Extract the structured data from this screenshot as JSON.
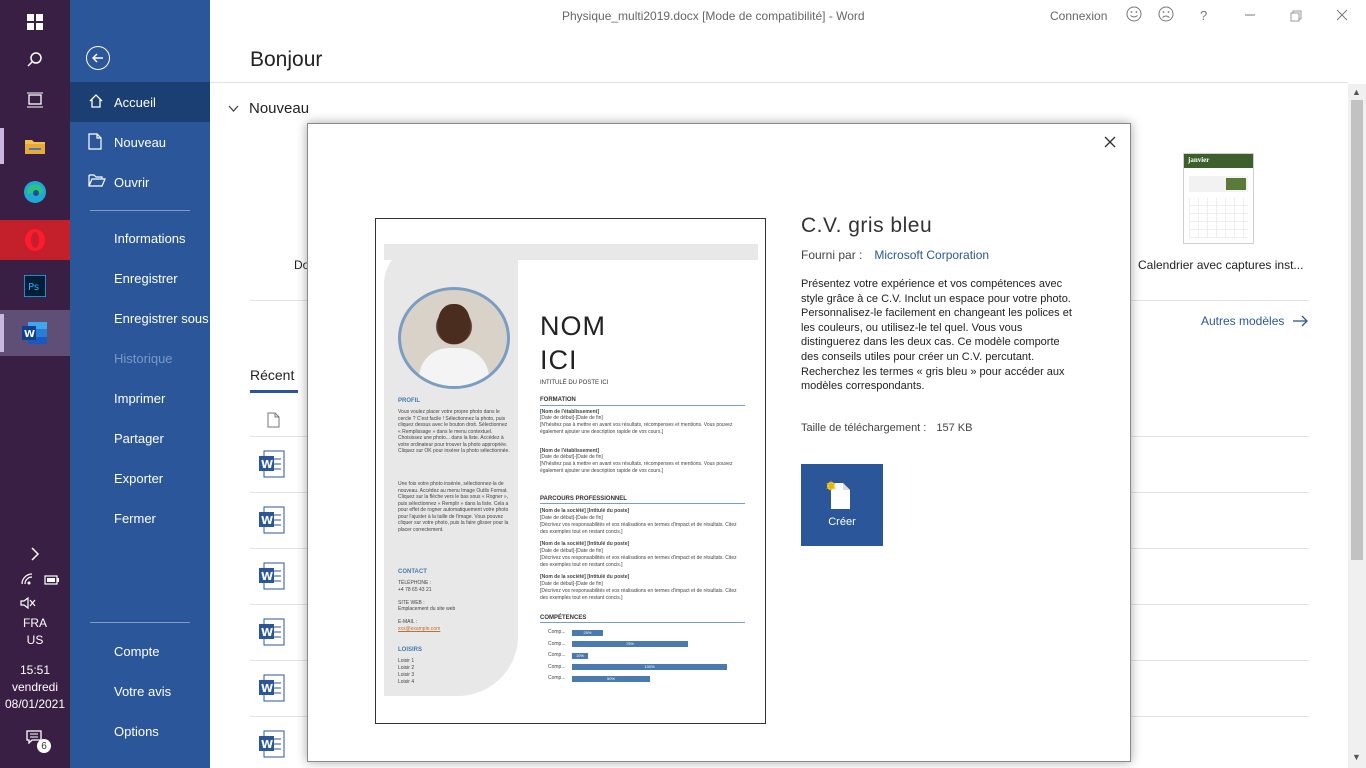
{
  "window": {
    "title": "Physique_multi2019.docx [Mode de compatibilité]  -  Word",
    "connexion": "Connexion"
  },
  "taskbar": {
    "language": "FRA",
    "region": "US",
    "time": "15:51",
    "day": "vendredi",
    "date": "08/01/2021",
    "notifications": "6"
  },
  "nav": {
    "items": [
      {
        "label": "Accueil"
      },
      {
        "label": "Nouveau"
      },
      {
        "label": "Ouvrir"
      },
      {
        "label": "Informations"
      },
      {
        "label": "Enregistrer"
      },
      {
        "label": "Enregistrer sous"
      },
      {
        "label": "Historique"
      },
      {
        "label": "Imprimer"
      },
      {
        "label": "Partager"
      },
      {
        "label": "Exporter"
      },
      {
        "label": "Fermer"
      },
      {
        "label": "Compte"
      },
      {
        "label": "Votre avis"
      },
      {
        "label": "Options"
      }
    ]
  },
  "main": {
    "greeting": "Bonjour",
    "new_section": "Nouveau",
    "template_partial_label": "Do",
    "calendar_template_label": "Calendrier avec captures inst...",
    "calendar_thumb_header": "janvier",
    "more_templates": "Autres modèles",
    "recent_tab": "Récent"
  },
  "modal": {
    "title": "C.V. gris bleu",
    "provider_label": "Fourni par :",
    "provider": "Microsoft Corporation",
    "description": "Présentez votre expérience et vos compétences avec style grâce à ce C.V. Inclut un espace pour votre photo. Personnalisez-le facilement en changeant les polices et les couleurs, ou utilisez-le tel quel. Vous vous distinguerez dans les deux cas. Ce modèle comporte des conseils utiles pour créer un C.V. percutant. Recherchez les termes « gris bleu » pour accéder aux modèles correspondants.",
    "size_label": "Taille de téléchargement :",
    "size_value": "157 KB",
    "create_label": "Créer"
  },
  "preview": {
    "name_line1": "NOM",
    "name_line2": "ICI",
    "job_title": "INTITULÉ DU POSTE ICI",
    "profil": "PROFIL",
    "profil_text": "Vous voulez placer votre propre photo dans le cercle ? C'est facile ! Sélectionnez la photo, puis cliquez dessus avec le bouton droit. Sélectionnez « Remplissage » dans le menu contextuel. Choisissez une photo... dans la liste. Accédez à votre ordinateur pour trouver la photo appropriée. Cliquez sur OK pour insérer la photo sélectionnée.",
    "profil_text2": "Une fois votre photo insérée, sélectionnez-la de nouveau. Accédez au menu Image Outils Format. Cliquez sur la flèche vers le bas sous « Rogner », puis sélectionnez « Remplir » dans la liste. Cela a pour effet de rogner automatiquement votre photo pour l'ajuster à la taille de l'image. Vous pouvez cliquer sur votre photo, puis la faire glisser pour la placer correctement.",
    "contact": "CONTACT",
    "phone_label": "TÉLÉPHONE :",
    "phone": "+4 78 65 43 21",
    "site_label": "SITE WEB :",
    "site": "Emplacement du site web",
    "email_label": "E-MAIL :",
    "email": "xxx@example.com",
    "loisirs": "LOISIRS",
    "loisirs_items": [
      "Loisir 1",
      "Loisir 2",
      "Loisir 3",
      "Loisir 4"
    ],
    "formation": "FORMATION",
    "etab": "[Nom de l'établissement]",
    "dates": "[Date de début]-[Date de fin]",
    "formation_desc": "[N'hésitez pas à mettre en avant vos résultats, récompenses et mentions. Vous pouvez également ajouter une description rapide de vos cours.]",
    "parcours": "PARCOURS PROFESSIONNEL",
    "societe": "[Nom de la société] [Intitulé du poste]",
    "parcours_desc": "[Décrivez vos responsabilités et vos réalisations en termes d'impact et de résultats. Citez des exemples tout en restant concis.]",
    "competences": "COMPÉTENCES",
    "skills": [
      {
        "label": "Comp...",
        "value": "20%",
        "fraction": 0.2
      },
      {
        "label": "Comp...",
        "value": "75%",
        "fraction": 0.75
      },
      {
        "label": "Comp...",
        "value": "10%",
        "fraction": 0.1
      },
      {
        "label": "Comp...",
        "value": "100%",
        "fraction": 1.0
      },
      {
        "label": "Comp...",
        "value": "50%",
        "fraction": 0.5
      }
    ]
  }
}
